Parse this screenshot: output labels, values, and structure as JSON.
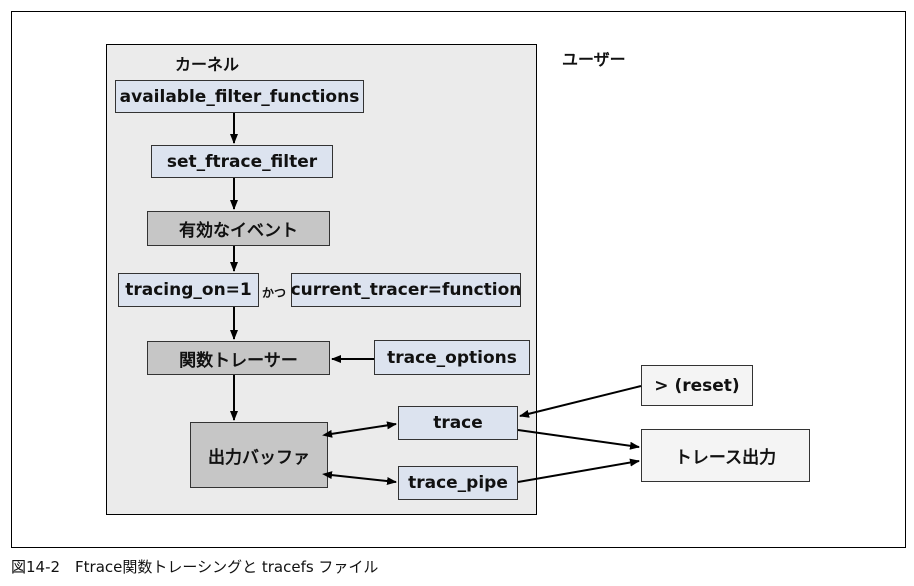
{
  "regions": {
    "kernel": "カーネル",
    "user": "ユーザー"
  },
  "nodes": {
    "available_filter_functions": "available_filter_functions",
    "set_ftrace_filter": "set_ftrace_filter",
    "enabled_events": "有効なイベント",
    "tracing_on": "tracing_on=1",
    "and_label": "かつ",
    "current_tracer": "current_tracer=function",
    "function_tracer": "関数トレーサー",
    "trace_options": "trace_options",
    "output_buffer": "出力バッファ",
    "trace": "trace",
    "trace_pipe": "trace_pipe",
    "reset": "> (reset)",
    "trace_output": "トレース出力"
  },
  "caption": "図14-2　Ftrace関数トレーシングと tracefs ファイル"
}
